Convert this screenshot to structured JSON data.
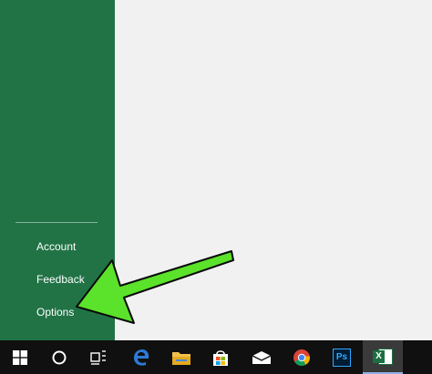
{
  "backstage": {
    "items": [
      {
        "label": "Account"
      },
      {
        "label": "Feedback"
      },
      {
        "label": "Options"
      }
    ]
  },
  "taskbar": {
    "excel_label": "X",
    "photoshop_label": "Ps"
  },
  "colors": {
    "excel_green": "#217346",
    "annotation_arrow": "#5be22a",
    "taskbar": "#101010"
  }
}
